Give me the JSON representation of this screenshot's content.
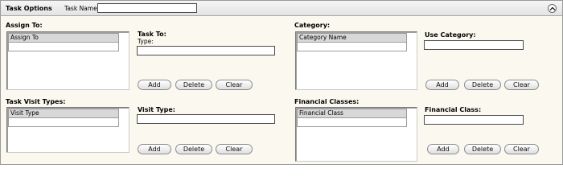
{
  "header": {
    "title": "Task Options",
    "task_name_label": "Task Name:",
    "task_name_value": "",
    "collapse_icon": "chevron-up-icon"
  },
  "assign_to": {
    "section_label": "Assign To:",
    "list_header": "Assign To",
    "side_label": "Task To:",
    "type_label": "Type:",
    "input_value": ""
  },
  "category": {
    "section_label": "Category:",
    "list_header": "Category Name",
    "side_label": "Use Category:",
    "input_value": ""
  },
  "task_visit_types": {
    "section_label": "Task Visit Types:",
    "list_header": "Visit Type",
    "side_label": "Visit Type:",
    "input_value": ""
  },
  "financial_classes": {
    "section_label": "Financial Classes:",
    "list_header": "Financial Class",
    "side_label": "Financial Class:",
    "input_value": ""
  },
  "buttons": {
    "add": "Add",
    "delete": "Delete",
    "clear": "Clear"
  }
}
